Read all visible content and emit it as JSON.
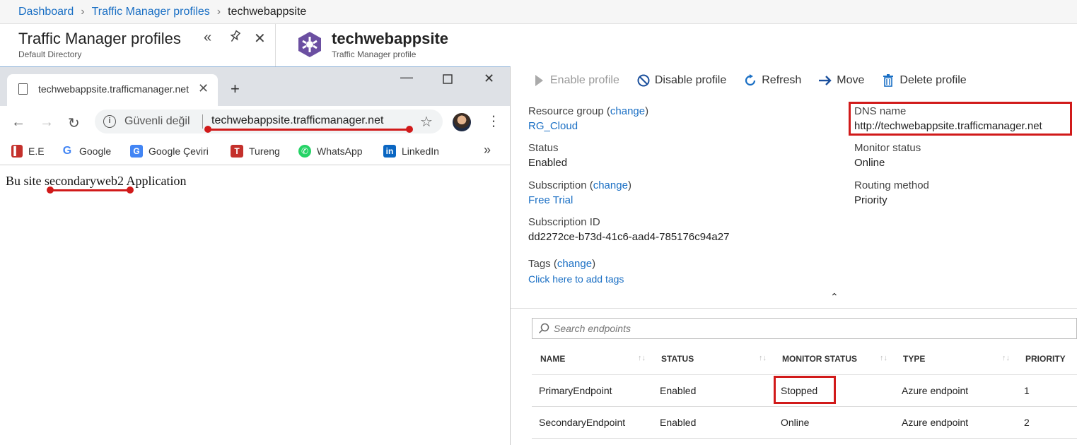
{
  "breadcrumb": {
    "items": [
      "Dashboard",
      "Traffic Manager profiles"
    ],
    "current": "techwebappsite"
  },
  "left_blade": {
    "title": "Traffic Manager profiles",
    "subtitle": "Default Directory"
  },
  "resource": {
    "title": "techwebappsite",
    "subtitle": "Traffic Manager profile",
    "icon": "traffic-manager-icon"
  },
  "toolbar": {
    "enable": "Enable profile",
    "disable": "Disable profile",
    "refresh": "Refresh",
    "move": "Move",
    "delete": "Delete profile"
  },
  "essentials": {
    "resource_group_label": "Resource group",
    "change": "change",
    "resource_group": "RG_Cloud",
    "status_label": "Status",
    "status": "Enabled",
    "subscription_label": "Subscription",
    "subscription": "Free Trial",
    "subscription_id_label": "Subscription ID",
    "subscription_id": "dd2272ce-b73d-41c6-aad4-785176c94a27",
    "tags_label": "Tags",
    "tags_add": "Click here to add tags",
    "dns_label": "DNS name",
    "dns": "http://techwebappsite.trafficmanager.net",
    "monitor_label": "Monitor status",
    "monitor": "Online",
    "routing_label": "Routing method",
    "routing": "Priority"
  },
  "endpoints": {
    "search_placeholder": "Search endpoints",
    "columns": [
      "NAME",
      "STATUS",
      "MONITOR STATUS",
      "TYPE",
      "PRIORITY"
    ],
    "rows": [
      {
        "name": "PrimaryEndpoint",
        "status": "Enabled",
        "monitor": "Stopped",
        "type": "Azure endpoint",
        "priority": "1"
      },
      {
        "name": "SecondaryEndpoint",
        "status": "Enabled",
        "monitor": "Online",
        "type": "Azure endpoint",
        "priority": "2"
      }
    ]
  },
  "browser": {
    "tab_title": "techwebappsite.trafficmanager.net",
    "security": "Güvenli değil",
    "url": "techwebappsite.trafficmanager.net",
    "bookmarks": [
      "E.E",
      "Google",
      "Google Çeviri",
      "Tureng",
      "WhatsApp",
      "LinkedIn"
    ],
    "page_text": "Bu site secondaryweb2 Application"
  },
  "colors": {
    "link": "#1a6fc4",
    "annotation": "#d11a1a"
  }
}
